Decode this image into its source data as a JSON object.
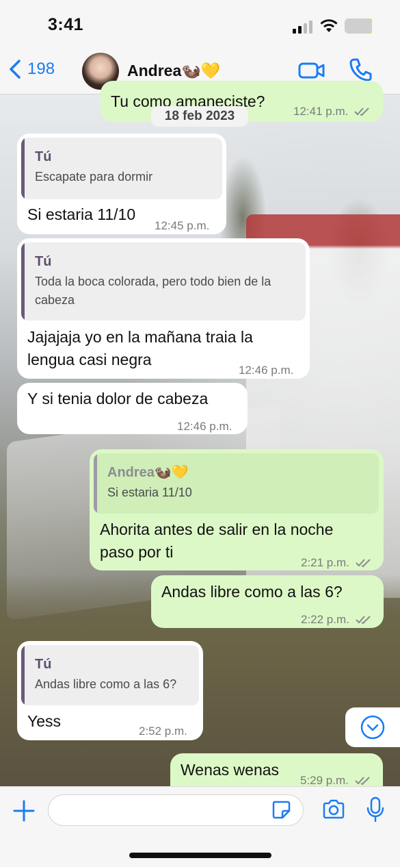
{
  "status_bar": {
    "time": "3:41",
    "battery": "28"
  },
  "header": {
    "back_count": "198",
    "contact_name": "Andrea🦦💛",
    "video_icon": "video-camera-icon",
    "phone_icon": "phone-icon"
  },
  "chat": {
    "date_separator": "18 feb 2023",
    "messages": [
      {
        "dir": "out",
        "text": "Tu como amaneciste?",
        "time": "12:41 p.m.",
        "status": "read"
      },
      {
        "dir": "in",
        "quote_author": "Tú",
        "quote_text": "Escapate para dormir",
        "text": "Si estaria 11/10",
        "time": "12:45 p.m."
      },
      {
        "dir": "in",
        "quote_author": "Tú",
        "quote_text": "Toda la boca colorada, pero todo bien de la cabeza",
        "text": "Jajajaja yo en la mañana traia la lengua casi negra",
        "time": "12:46 p.m."
      },
      {
        "dir": "in",
        "text": "Y si tenia dolor de cabeza",
        "time": "12:46 p.m."
      },
      {
        "dir": "out",
        "quote_author": "Andrea🦦💛",
        "quote_text": "Si estaria 11/10",
        "text": "Ahorita antes de salir en la noche paso por ti",
        "time": "2:21 p.m.",
        "status": "read"
      },
      {
        "dir": "out",
        "text": "Andas libre como a las 6?",
        "time": "2:22 p.m.",
        "status": "read"
      },
      {
        "dir": "in",
        "quote_author": "Tú",
        "quote_text": "Andas libre como a las 6?",
        "text": "Yess",
        "time": "2:52 p.m."
      },
      {
        "dir": "out",
        "text": "Wenas wenas",
        "time": "5:29 p.m.",
        "status": "read"
      }
    ]
  },
  "composer": {
    "input_placeholder": "",
    "icons": [
      "plus-icon",
      "sticker-icon",
      "camera-icon",
      "microphone-icon"
    ]
  },
  "colors": {
    "accent": "#1a7cf3",
    "outgoing_bubble": "#dcf8c6",
    "incoming_bubble": "#ffffff",
    "battery": "#f7d21b"
  }
}
